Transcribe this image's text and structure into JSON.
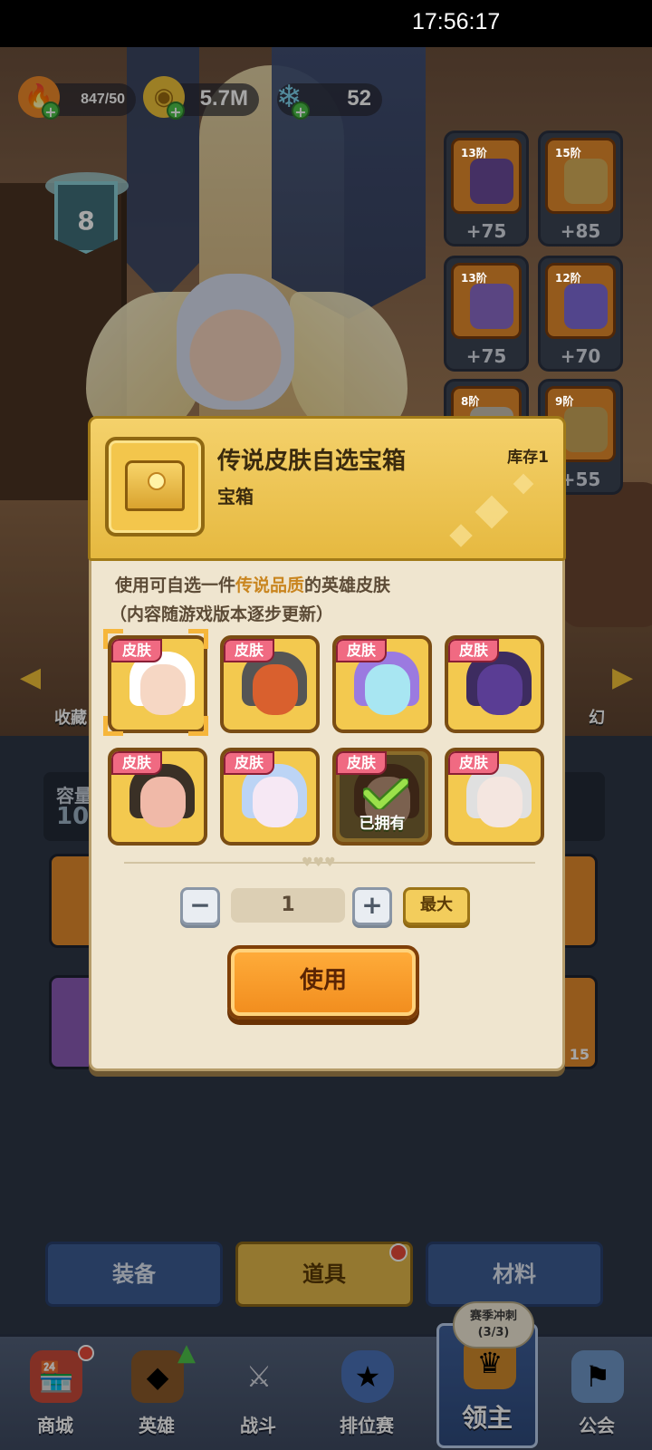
{
  "status_bar": {
    "time": "17:56:17"
  },
  "resources": {
    "energy": {
      "value": "847/50",
      "icon": "flame-icon"
    },
    "gold": {
      "value": "5.7M",
      "icon": "coin-icon"
    },
    "gems": {
      "value": "52",
      "icon": "crystal-icon"
    }
  },
  "player": {
    "level": "8"
  },
  "equipment": [
    {
      "tier": "13阶",
      "bonus": "+75",
      "icon": "helmet-icon",
      "color": "#6a4a9a"
    },
    {
      "tier": "15阶",
      "bonus": "+85",
      "icon": "armor-icon",
      "color": "#d8b05a"
    },
    {
      "tier": "13阶",
      "bonus": "+75",
      "icon": "boots-icon",
      "color": "#8a6ac8"
    },
    {
      "tier": "12阶",
      "bonus": "+70",
      "icon": "gauntlet-icon",
      "color": "#7f6ad8"
    },
    {
      "tier": "8阶",
      "bonus": "",
      "icon": "ring-icon",
      "color": "#c8c0b0"
    },
    {
      "tier": "9阶",
      "bonus": "+55",
      "icon": "belt-icon",
      "color": "#c9a75a"
    }
  ],
  "side_labels": {
    "left": "收藏",
    "right": "幻"
  },
  "capacity": {
    "label": "容量",
    "value": "10"
  },
  "lower_slot_count": "15",
  "tabs": [
    {
      "label": "装备",
      "active": false
    },
    {
      "label": "道具",
      "active": true
    },
    {
      "label": "材料",
      "active": false
    }
  ],
  "season": {
    "title": "赛季冲刺",
    "progress": "(3/3)"
  },
  "nav": [
    {
      "label": "商城",
      "icon": "shop-icon"
    },
    {
      "label": "英雄",
      "icon": "hero-card-icon"
    },
    {
      "label": "战斗",
      "icon": "crossed-swords-icon"
    },
    {
      "label": "排位赛",
      "icon": "rank-shield-icon"
    },
    {
      "label": "领主",
      "icon": "crown-banner-icon",
      "active": true
    },
    {
      "label": "公会",
      "icon": "guild-castle-icon"
    }
  ],
  "modal": {
    "title": "传说皮肤自选宝箱",
    "type": "宝箱",
    "stock": "库存1",
    "desc_prefix": "使用可自选一件",
    "desc_highlight": "传说品质",
    "desc_suffix": "的英雄皮肤",
    "desc_line2": "（内容随游戏版本逐步更新）",
    "skin_tag": "皮肤",
    "owned_label": "已拥有",
    "skins": [
      {
        "name": "white-hair-girl",
        "bg": "#f3c94f",
        "face": "#f6d7c4",
        "hair": "#ffffff",
        "selected": true,
        "owned": false
      },
      {
        "name": "dino-warrior",
        "bg": "#f3c94f",
        "face": "#d9602e",
        "hair": "#555555",
        "selected": false,
        "owned": false
      },
      {
        "name": "cyan-spirit",
        "bg": "#f3c94f",
        "face": "#a8e6f2",
        "hair": "#9b7ae0",
        "selected": false,
        "owned": false
      },
      {
        "name": "purple-robot",
        "bg": "#f3c94f",
        "face": "#5a3d94",
        "hair": "#3d2c60",
        "selected": false,
        "owned": false
      },
      {
        "name": "hooded-rogue",
        "bg": "#f3c94f",
        "face": "#f0b9a8",
        "hair": "#3a3026",
        "selected": false,
        "owned": false
      },
      {
        "name": "fluffy-beast",
        "bg": "#f3c94f",
        "face": "#f6e8f4",
        "hair": "#bcd4f5",
        "selected": false,
        "owned": false
      },
      {
        "name": "brown-hair-hero",
        "bg": "#8a6c2a",
        "face": "#d6a07a",
        "hair": "#6a3c1c",
        "selected": false,
        "owned": true
      },
      {
        "name": "oni-mask",
        "bg": "#f3c94f",
        "face": "#f4e6e0",
        "hair": "#e0e0e0",
        "selected": false,
        "owned": false
      }
    ],
    "quantity": "1",
    "minus": "−",
    "plus": "+",
    "max_label": "最大",
    "use_label": "使用"
  },
  "colors": {
    "accent_gold": "#e3b94a",
    "accent_orange": "#f18c1d",
    "skin_tag_pink": "#f06a82",
    "highlight": "#c9851f"
  }
}
